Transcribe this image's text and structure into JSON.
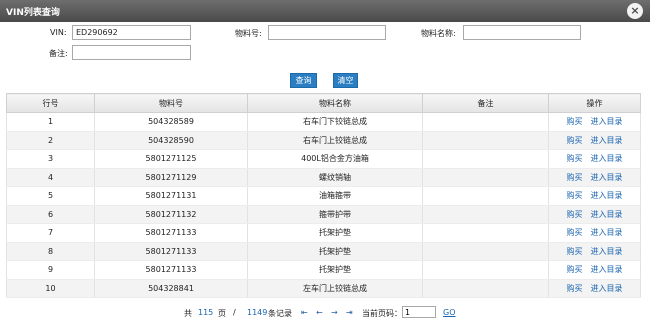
{
  "dialog": {
    "title": "VIN列表查询",
    "close_glyph": "×"
  },
  "form": {
    "vin_label": "VIN:",
    "vin_value": "ED290692",
    "part_no_label": "物料号:",
    "part_no_value": "",
    "part_name_label": "物料名称:",
    "part_name_value": "",
    "remark_label": "备注:",
    "remark_value": "",
    "search_label": "查询",
    "clear_label": "清空"
  },
  "table": {
    "headers": [
      "行号",
      "物料号",
      "物料名称",
      "备注",
      "操作"
    ],
    "buy_label": "购买",
    "catalog_label": "进入目录",
    "rows": [
      {
        "no": "1",
        "part_no": "504328589",
        "name": "右车门下铰链总成",
        "remark": ""
      },
      {
        "no": "2",
        "part_no": "504328590",
        "name": "右车门上铰链总成",
        "remark": ""
      },
      {
        "no": "3",
        "part_no": "5801271125",
        "name": "400L铝合金方油箱",
        "remark": ""
      },
      {
        "no": "4",
        "part_no": "5801271129",
        "name": "螺纹销轴",
        "remark": ""
      },
      {
        "no": "5",
        "part_no": "5801271131",
        "name": "油箱箍带",
        "remark": ""
      },
      {
        "no": "6",
        "part_no": "5801271132",
        "name": "箍带护带",
        "remark": ""
      },
      {
        "no": "7",
        "part_no": "5801271133",
        "name": "托架护垫",
        "remark": ""
      },
      {
        "no": "8",
        "part_no": "5801271133",
        "name": "托架护垫",
        "remark": ""
      },
      {
        "no": "9",
        "part_no": "5801271133",
        "name": "托架护垫",
        "remark": ""
      },
      {
        "no": "10",
        "part_no": "504328841",
        "name": "左车门上铰链总成",
        "remark": ""
      }
    ]
  },
  "pager": {
    "total_prefix": "共",
    "total_pages": "115",
    "pages_suffix": "页",
    "slash": "/",
    "total_records": "1149",
    "records_suffix": "条记录",
    "first_glyph": "⇤",
    "prev_glyph": "←",
    "next_glyph": "→",
    "last_glyph": "⇥",
    "current_label": "当前页码：",
    "current_page": "1",
    "go_label": "GO"
  },
  "colors": {
    "accent": "#2b7ec1",
    "link": "#1a64b0",
    "titlebar": "#5a5a5a"
  }
}
